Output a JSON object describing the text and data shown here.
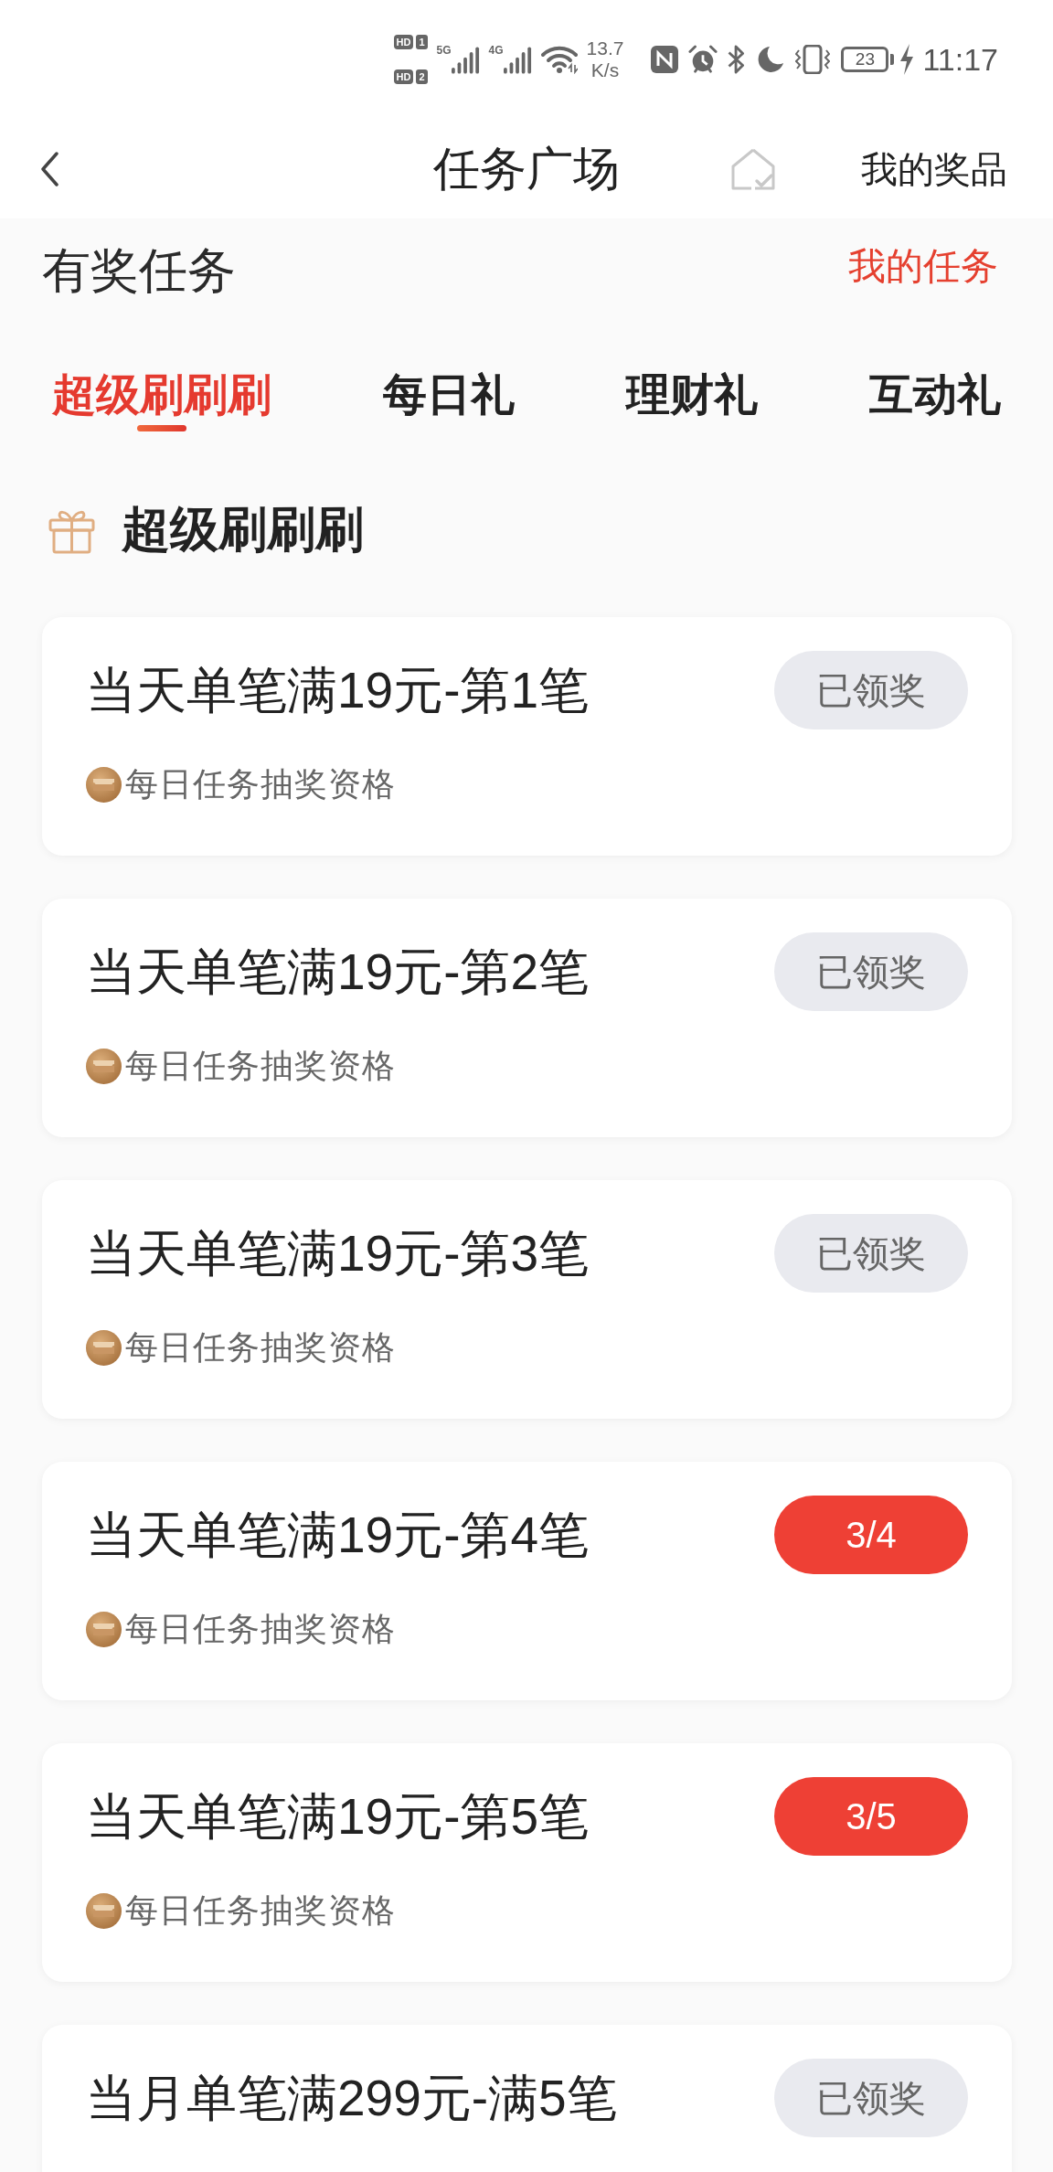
{
  "status_bar": {
    "sims": [
      {
        "label": "HD",
        "slot": "1"
      },
      {
        "label": "HD",
        "slot": "2"
      }
    ],
    "networks": [
      "5G",
      "4G"
    ],
    "speed": {
      "value": "13.7",
      "unit": "K/s"
    },
    "battery": "23",
    "time": "11:17"
  },
  "nav": {
    "title": "任务广场",
    "action": "我的奖品"
  },
  "section_header": {
    "title": "有奖任务",
    "link": "我的任务"
  },
  "tabs": [
    {
      "label": "超级刷刷刷",
      "selected": true
    },
    {
      "label": "每日礼",
      "selected": false
    },
    {
      "label": "理财礼",
      "selected": false
    },
    {
      "label": "互动礼",
      "selected": false
    }
  ],
  "group": {
    "title": "超级刷刷刷"
  },
  "tasks": [
    {
      "title": "当天单笔满19元-第1笔",
      "reward": "每日任务抽奖资格",
      "status": "已领奖",
      "kind": "claimed"
    },
    {
      "title": "当天单笔满19元-第2笔",
      "reward": "每日任务抽奖资格",
      "status": "已领奖",
      "kind": "claimed"
    },
    {
      "title": "当天单笔满19元-第3笔",
      "reward": "每日任务抽奖资格",
      "status": "已领奖",
      "kind": "claimed"
    },
    {
      "title": "当天单笔满19元-第4笔",
      "reward": "每日任务抽奖资格",
      "status": "3/4",
      "kind": "progress"
    },
    {
      "title": "当天单笔满19元-第5笔",
      "reward": "每日任务抽奖资格",
      "status": "3/5",
      "kind": "progress"
    },
    {
      "title": "当月单笔满299元-满5笔",
      "status": "已领奖",
      "kind": "claimed"
    }
  ]
}
